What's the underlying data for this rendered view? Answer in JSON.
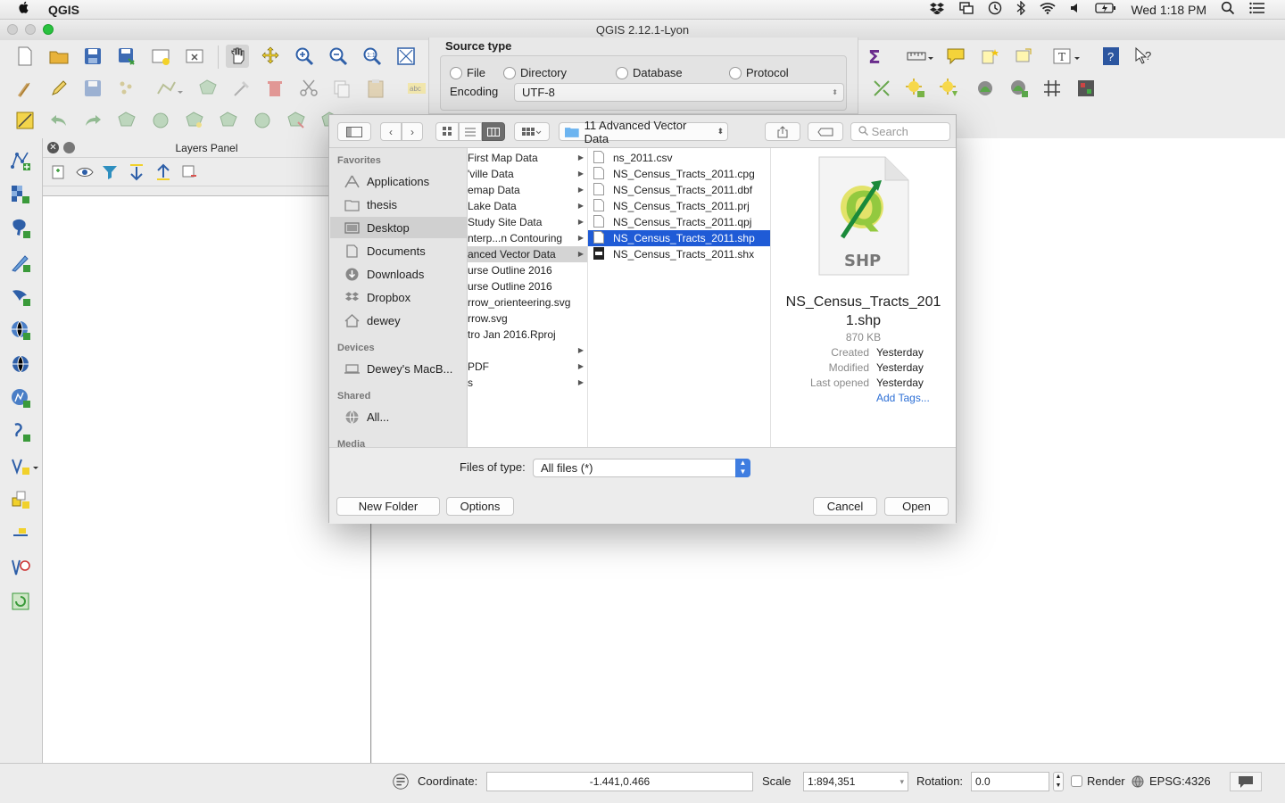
{
  "menubar": {
    "app_name": "QGIS",
    "clock": "Wed 1:18 PM"
  },
  "window": {
    "title": "QGIS 2.12.1-Lyon"
  },
  "layers_panel": {
    "title": "Layers Panel"
  },
  "source_dialog": {
    "title": "Source type",
    "options": [
      "File",
      "Directory",
      "Database",
      "Protocol"
    ],
    "encoding_label": "Encoding",
    "encoding_value": "UTF-8"
  },
  "file_dialog": {
    "path_label": "11 Advanced Vector Data",
    "search_placeholder": "Search",
    "sidebar": {
      "favorites_header": "Favorites",
      "favorites": [
        "Applications",
        "thesis",
        "Desktop",
        "Documents",
        "Downloads",
        "Dropbox",
        "dewey"
      ],
      "devices_header": "Devices",
      "devices": [
        "Dewey's MacB..."
      ],
      "shared_header": "Shared",
      "shared": [
        "All..."
      ],
      "media_header": "Media"
    },
    "column1": [
      {
        "name": "First Map Data",
        "folder": true
      },
      {
        "name": "'ville Data",
        "folder": true
      },
      {
        "name": "emap Data",
        "folder": true
      },
      {
        "name": " Lake Data",
        "folder": true
      },
      {
        "name": "Study Site Data",
        "folder": true
      },
      {
        "name": "nterp...n Contouring",
        "folder": true
      },
      {
        "name": "anced Vector Data",
        "folder": true
      },
      {
        "name": "urse Outline 2016",
        "folder": false
      },
      {
        "name": "urse Outline 2016",
        "folder": false
      },
      {
        "name": "rrow_orienteering.svg",
        "folder": false
      },
      {
        "name": "rrow.svg",
        "folder": false
      },
      {
        "name": "tro Jan 2016.Rproj",
        "folder": false
      },
      {
        "name": "",
        "folder": true
      },
      {
        "name": " PDF",
        "folder": true
      },
      {
        "name": "s",
        "folder": true
      }
    ],
    "column2": [
      "ns_2011.csv",
      "NS_Census_Tracts_2011.cpg",
      "NS_Census_Tracts_2011.dbf",
      "NS_Census_Tracts_2011.prj",
      "NS_Census_Tracts_2011.qpj",
      "NS_Census_Tracts_2011.shp",
      "NS_Census_Tracts_2011.shx"
    ],
    "preview": {
      "icon_label": "SHP",
      "filename_line1": "NS_Census_Tracts_201",
      "filename_line2": "1.shp",
      "size": "870 KB",
      "created_label": "Created",
      "created_value": "Yesterday",
      "modified_label": "Modified",
      "modified_value": "Yesterday",
      "opened_label": "Last opened",
      "opened_value": "Yesterday",
      "tags_link": "Add Tags..."
    },
    "files_of_type_label": "Files of type:",
    "files_of_type_value": "All files (*)",
    "new_folder": "New Folder",
    "options": "Options",
    "cancel": "Cancel",
    "open": "Open"
  },
  "statusbar": {
    "coordinate_label": "Coordinate:",
    "coordinate_value": "-1.441,0.466",
    "scale_label": "Scale",
    "scale_value": "1:894,351",
    "rotation_label": "Rotation:",
    "rotation_value": "0.0",
    "render_label": "Render",
    "crs": "EPSG:4326"
  }
}
